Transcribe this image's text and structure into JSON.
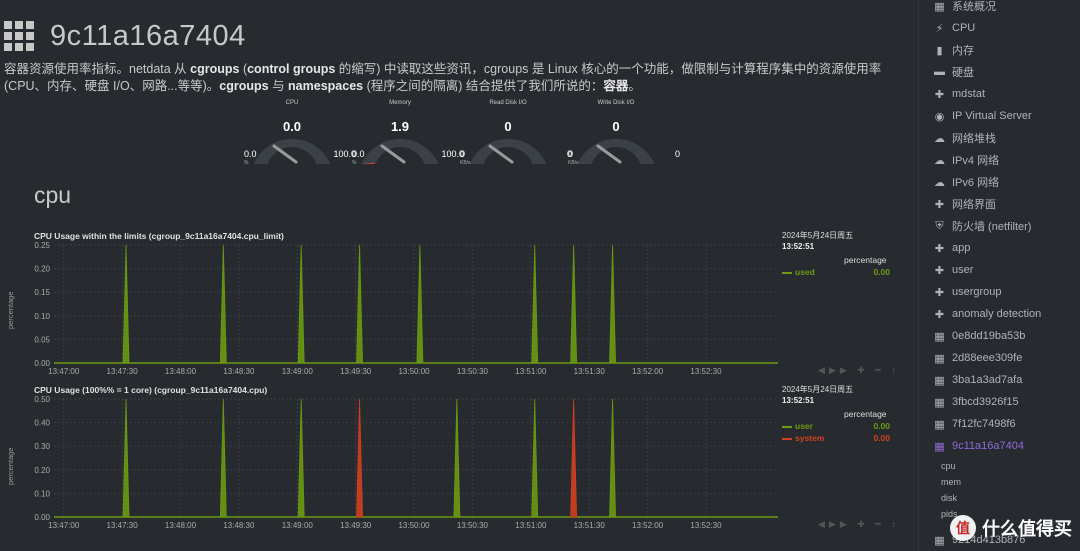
{
  "header": {
    "title": "9c11a16a7404",
    "desc_plain_1": "容器资源使用率指标。netdata 从 ",
    "desc_b1": "cgroups",
    "desc_plain_2": " (",
    "desc_b2": "control groups",
    "desc_plain_3": " 的缩写) 中读取这些资讯，cgroups 是 Linux 核心的一个功能，做限制与计算程序集中的资源使用率 (CPU、内存、硬盘 I/O、网路...等等)。",
    "desc_b3": "cgroups",
    "desc_plain_4": " 与 ",
    "desc_b4": "namespaces",
    "desc_plain_5": " (程序之间的隔离) 结合提供了我们所说的：",
    "desc_b5": "容器",
    "desc_plain_6": "。"
  },
  "gauges": [
    {
      "title": "CPU",
      "value": "0.0",
      "min": "0.0",
      "max": "100.0",
      "unit": "%",
      "fraction": 0.0,
      "color": "#cccccc"
    },
    {
      "title": "Memory",
      "value": "1.9",
      "min": "0.0",
      "max": "100.0",
      "unit": "%",
      "fraction": 0.019,
      "color": "#d14836"
    },
    {
      "title": "Read Disk I/O",
      "value": "0",
      "min": "0",
      "max": "0",
      "unit": "KB/s",
      "fraction": 0.0,
      "color": "#cccccc"
    },
    {
      "title": "Write Disk I/O",
      "value": "0",
      "min": "0",
      "max": "0",
      "unit": "KB/s",
      "fraction": 0.0,
      "color": "#cccccc"
    }
  ],
  "section_title": "cpu",
  "colors": {
    "user": "#6b9a12",
    "system": "#d13f1f",
    "used": "#6b9a12",
    "grid": "#3a3f45"
  },
  "chart_data": [
    {
      "type": "area",
      "title": "CPU Usage within the limits (cgroup_9c11a16a7404.cpu_limit)",
      "ylabel": "percentage",
      "ylim": [
        0,
        0.25
      ],
      "yticks": [
        "0.25",
        "0.20",
        "0.15",
        "0.10",
        "0.05",
        "0.00"
      ],
      "xticks": [
        "13:47:00",
        "13:47:30",
        "13:48:00",
        "13:48:30",
        "13:49:00",
        "13:49:30",
        "13:50:00",
        "13:50:30",
        "13:51:00",
        "13:51:30",
        "13:52:00",
        "13:52:30"
      ],
      "x_range_seconds": [
        0,
        372
      ],
      "series": [
        {
          "name": "used",
          "spikes": [
            {
              "t": 37,
              "v": 0.25
            },
            {
              "t": 87,
              "v": 0.25
            },
            {
              "t": 127,
              "v": 0.25
            },
            {
              "t": 157,
              "v": 0.25
            },
            {
              "t": 188,
              "v": 0.25
            },
            {
              "t": 247,
              "v": 0.25
            },
            {
              "t": 267,
              "v": 0.25
            },
            {
              "t": 287,
              "v": 0.25
            }
          ]
        }
      ],
      "legend": {
        "date": "2024年5月24日周五",
        "time": "13:52:51",
        "unit": "percentage",
        "rows": [
          {
            "name": "used",
            "value": "0.00"
          }
        ]
      }
    },
    {
      "type": "area",
      "title": "CPU Usage (100%% = 1 core) (cgroup_9c11a16a7404.cpu)",
      "ylabel": "percentage",
      "ylim": [
        0,
        0.5
      ],
      "yticks": [
        "0.50",
        "0.40",
        "0.30",
        "0.20",
        "0.10",
        "0.00"
      ],
      "xticks": [
        "13:47:00",
        "13:47:30",
        "13:48:00",
        "13:48:30",
        "13:49:00",
        "13:49:30",
        "13:50:00",
        "13:50:30",
        "13:51:00",
        "13:51:30",
        "13:52:00",
        "13:52:30"
      ],
      "x_range_seconds": [
        0,
        372
      ],
      "series": [
        {
          "name": "user",
          "spikes": [
            {
              "t": 37,
              "v": 0.5
            },
            {
              "t": 87,
              "v": 0.5
            },
            {
              "t": 127,
              "v": 0.5
            },
            {
              "t": 207,
              "v": 0.5
            },
            {
              "t": 247,
              "v": 0.5
            },
            {
              "t": 287,
              "v": 0.5
            }
          ]
        },
        {
          "name": "system",
          "spikes": [
            {
              "t": 157,
              "v": 0.5
            },
            {
              "t": 267,
              "v": 0.5
            }
          ]
        }
      ],
      "legend": {
        "date": "2024年5月24日周五",
        "time": "13:52:51",
        "unit": "percentage",
        "rows": [
          {
            "name": "user",
            "value": "0.00"
          },
          {
            "name": "system",
            "value": "0.00"
          }
        ]
      }
    }
  ],
  "sidebar": {
    "items": [
      {
        "icon": "▦",
        "icon_name": "overview-icon",
        "label": "系统概况"
      },
      {
        "icon": "⚡",
        "icon_name": "bolt-icon",
        "label": "CPU"
      },
      {
        "icon": "▮",
        "icon_name": "memory-icon",
        "label": "内存"
      },
      {
        "icon": "▬",
        "icon_name": "disk-icon",
        "label": "硬盘"
      },
      {
        "icon": "✚",
        "icon_name": "puzzle-icon",
        "label": "mdstat"
      },
      {
        "icon": "◉",
        "icon_name": "eye-icon",
        "label": "IP Virtual Server"
      },
      {
        "icon": "☁",
        "icon_name": "cloud-icon",
        "label": "网络堆栈"
      },
      {
        "icon": "☁",
        "icon_name": "cloud-icon",
        "label": "IPv4 网络"
      },
      {
        "icon": "☁",
        "icon_name": "cloud-icon",
        "label": "IPv6 网络"
      },
      {
        "icon": "✚",
        "icon_name": "puzzle-icon",
        "label": "网络界面"
      },
      {
        "icon": "⛨",
        "icon_name": "shield-icon",
        "label": "防火墙 (netfilter)"
      },
      {
        "icon": "✚",
        "icon_name": "puzzle-icon",
        "label": "app"
      },
      {
        "icon": "✚",
        "icon_name": "puzzle-icon",
        "label": "user"
      },
      {
        "icon": "✚",
        "icon_name": "puzzle-icon",
        "label": "usergroup"
      },
      {
        "icon": "✚",
        "icon_name": "puzzle-icon",
        "label": "anomaly detection"
      },
      {
        "icon": "▦",
        "icon_name": "grid-icon",
        "label": "0e8dd19ba53b"
      },
      {
        "icon": "▦",
        "icon_name": "grid-icon",
        "label": "2d88eee309fe"
      },
      {
        "icon": "▦",
        "icon_name": "grid-icon",
        "label": "3ba1a3ad7afa"
      },
      {
        "icon": "▦",
        "icon_name": "grid-icon",
        "label": "3fbcd3926f15"
      },
      {
        "icon": "▦",
        "icon_name": "grid-icon",
        "label": "7f12fc7498f6"
      },
      {
        "icon": "▦",
        "icon_name": "grid-icon",
        "label": "9c11a16a7404"
      }
    ],
    "subitems": [
      "cpu",
      "mem",
      "disk",
      "pids"
    ],
    "last_item": "9214d413b876"
  },
  "watermark": {
    "icon_text": "值",
    "text": "什么值得买"
  }
}
